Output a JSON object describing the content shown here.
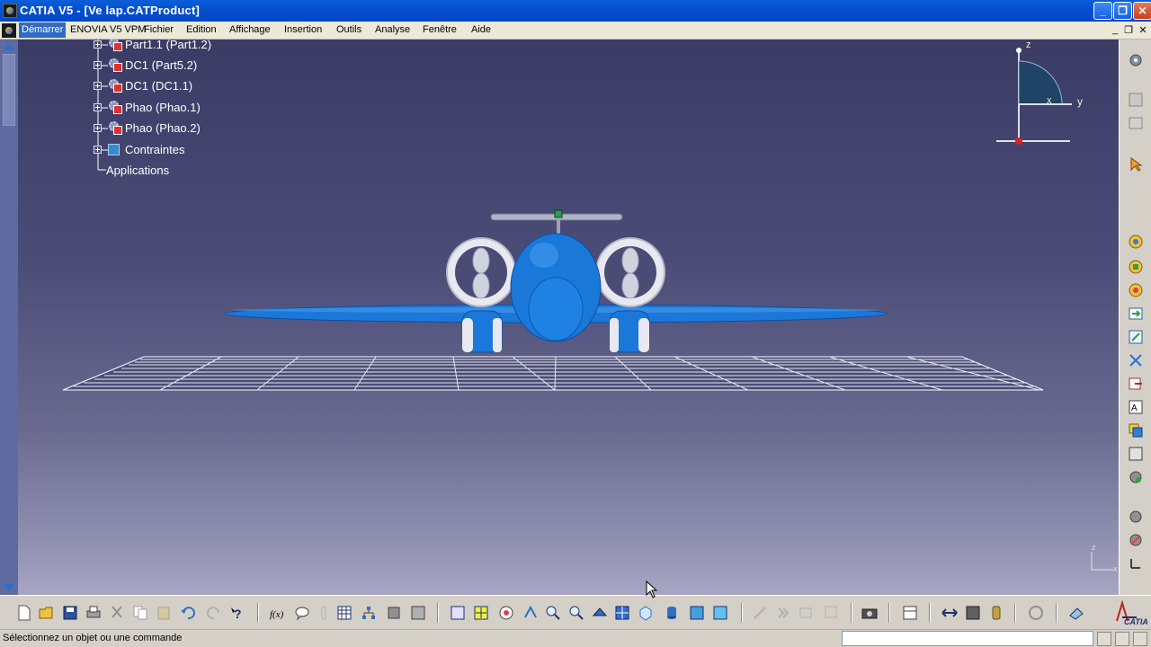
{
  "window": {
    "title": "CATIA V5 - [Ve lap.CATProduct]",
    "min_btn": "_",
    "restore_btn": "❐",
    "close_btn": "✕"
  },
  "menu": {
    "items": [
      {
        "label": "Démarrer"
      },
      {
        "label": "ENOVIA V5 VPM"
      },
      {
        "label": "Fichier"
      },
      {
        "label": "Edition"
      },
      {
        "label": "Affichage"
      },
      {
        "label": "Insertion"
      },
      {
        "label": "Outils"
      },
      {
        "label": "Analyse"
      },
      {
        "label": "Fenêtre"
      },
      {
        "label": "Aide"
      }
    ],
    "mdi": {
      "minimize": "_",
      "restore": "❐",
      "close": "✕"
    }
  },
  "tree": {
    "nodes": [
      {
        "label": "Part1.1 (Part1.2)",
        "icon": "part-icon"
      },
      {
        "label": "DC1 (Part5.2)",
        "icon": "part-icon"
      },
      {
        "label": "DC1 (DC1.1)",
        "icon": "part-icon"
      },
      {
        "label": "Phao (Phao.1)",
        "icon": "part-icon"
      },
      {
        "label": "Phao (Phao.2)",
        "icon": "part-icon"
      },
      {
        "label": "Contraintes",
        "icon": "constraints-icon"
      }
    ],
    "applications": "Applications"
  },
  "compass": {
    "z": "z",
    "y": "y",
    "x": "x"
  },
  "mini_axis": {
    "z": "z",
    "x": "x"
  },
  "status": {
    "message": "Sélectionnez un objet ou une commande",
    "command_value": ""
  },
  "colors": {
    "titlebar": "#0550d1",
    "viewport_top": "#3a3c66",
    "viewport_bottom": "#a7a5c2",
    "model_blue": "#1a78d8",
    "grid": "#ffffff"
  }
}
